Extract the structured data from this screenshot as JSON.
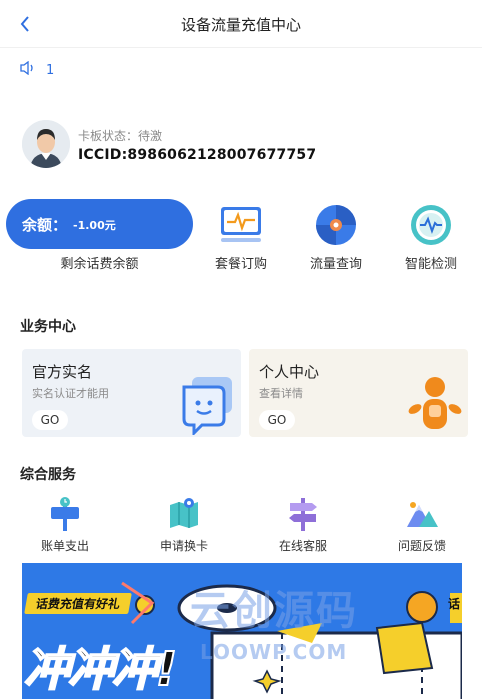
{
  "header": {
    "back_icon": "chevron-left-icon",
    "title": "设备流量充值中心"
  },
  "notice": {
    "icon": "speaker-icon",
    "text": "1"
  },
  "card": {
    "status": "卡板状态：待激",
    "iccid": "ICCID:8986062128007677757"
  },
  "balance": {
    "label": "余额：",
    "value": "-1.00元",
    "caption": "剩余话费余额"
  },
  "quick_actions": [
    {
      "label": "套餐订购",
      "icon": "monitor-pulse-icon"
    },
    {
      "label": "流量查询",
      "icon": "disc-icon"
    },
    {
      "label": "智能检测",
      "icon": "heart-rate-icon"
    }
  ],
  "business": {
    "title": "业务中心",
    "cards": [
      {
        "title": "官方实名",
        "subtitle": "实名认证才能用",
        "button": "GO",
        "icon": "chat-bubble-face-icon"
      },
      {
        "title": "个人中心",
        "subtitle": "查看详情",
        "button": "GO",
        "icon": "person-icon"
      }
    ]
  },
  "services": {
    "title": "综合服务",
    "items": [
      {
        "label": "账单支出",
        "icon": "bill-signpost-icon"
      },
      {
        "label": "申请换卡",
        "icon": "map-pin-icon"
      },
      {
        "label": "在线客服",
        "icon": "direction-sign-icon"
      },
      {
        "label": "问题反馈",
        "icon": "mountain-icon"
      }
    ]
  },
  "banner": {
    "tag": "话费充值有好礼",
    "headline": "冲冲冲!",
    "corner": "话"
  },
  "watermark": {
    "text": "云创源码",
    "domain": "LOOWP.COM"
  },
  "colors": {
    "primary": "#2f6fe0",
    "card_left": "#eef2f7",
    "card_right": "#f6f3ec",
    "banner": "#2e79e6",
    "orange": "#f08a1c"
  }
}
